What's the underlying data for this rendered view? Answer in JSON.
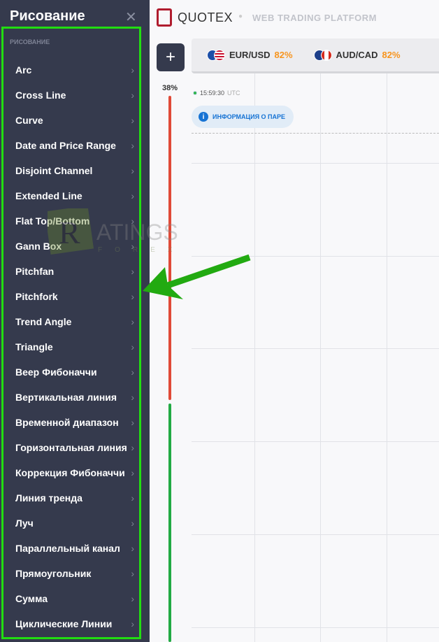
{
  "sidebar": {
    "title": "Рисование",
    "close_icon": "close-icon",
    "section": "РИСОВАНИЕ",
    "items": [
      "Arc",
      "Cross Line",
      "Curve",
      "Date and Price Range",
      "Disjoint Channel",
      "Extended Line",
      "Flat Top/Bottom",
      "Gann Box",
      "Pitchfan",
      "Pitchfork",
      "Trend Angle",
      "Triangle",
      "Веер Фибоначчи",
      "Вертикальная линия",
      "Временной диапазон",
      "Горизонтальная линия",
      "Коррекция Фибоначчи",
      "Линия тренда",
      "Луч",
      "Параллельный канал",
      "Прямоугольник",
      "Сумма",
      "Циклические Линии"
    ],
    "chevron": "›"
  },
  "header": {
    "brand": "QUOTEX",
    "tagline": "WEB TRADING PLATFORM",
    "add_label": "+"
  },
  "pairs": [
    {
      "name": "EUR/USD",
      "payout": "82%"
    },
    {
      "name": "AUD/CAD",
      "payout": "82%"
    }
  ],
  "chart": {
    "sentiment": "38%",
    "sentiment_value": 38,
    "time": "15:59:30",
    "tz": "UTC",
    "info_label": "ИНФОРМАЦИЯ О ПАРЕ",
    "info_icon": "i",
    "colors": {
      "down": "#e04a38",
      "up": "#22aa44",
      "accent": "#f7941d"
    }
  },
  "watermark": "RATINGS FOREX"
}
